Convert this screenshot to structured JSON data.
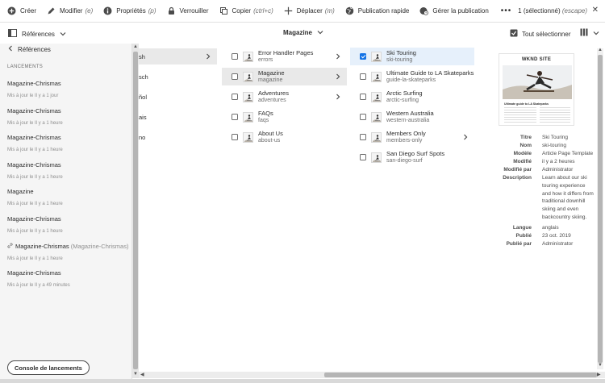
{
  "actionbar": {
    "create": "Créer",
    "edit": "Modifier",
    "edit_shortcut": "(e)",
    "properties": "Propriétés",
    "properties_shortcut": "(p)",
    "lock": "Verrouiller",
    "copy": "Copier",
    "copy_shortcut": "(ctrl+c)",
    "move": "Déplacer",
    "move_shortcut": "(m)",
    "quick_publish": "Publication rapide",
    "manage_publication": "Gérer la publication",
    "more": "•••",
    "selection_count": "1 (sélectionné)",
    "selection_escape": "(escape)"
  },
  "subbar": {
    "rail_label": "Références",
    "breadcrumb": "Magazine",
    "select_all": "Tout sélectionner"
  },
  "rail": {
    "back_label": "Références",
    "section_title": "LANCEMENTS",
    "launches": [
      {
        "title": "Magazine-Chrismas",
        "sub": "",
        "meta": "Mis à jour le Il y a 1 jour"
      },
      {
        "title": "Magazine-Chrismas",
        "sub": "",
        "meta": "Mis à jour le Il y a 1 heure"
      },
      {
        "title": "Magazine-Chrismas",
        "sub": "",
        "meta": "Mis à jour le Il y a 1 heure"
      },
      {
        "title": "Magazine-Chrismas",
        "sub": "",
        "meta": "Mis à jour le Il y a 1 heure"
      },
      {
        "title": "Magazine",
        "sub": "",
        "meta": "Mis à jour le Il y a 1 heure"
      },
      {
        "title": "Magazine-Chrismas",
        "sub": "",
        "meta": "Mis à jour le Il y a 1 heure"
      },
      {
        "title": "Magazine-Chrismas",
        "sub": "(Magazine-Chrismas)",
        "meta": "Mis à jour le Il y a 1 heure"
      },
      {
        "title": "Magazine-Chrismas",
        "sub": "",
        "meta": "Mis à jour le Il y a 49 minutes"
      }
    ],
    "console_button": "Console de lancements"
  },
  "column0": [
    "sh",
    "sch",
    "ñol",
    "ais",
    "no"
  ],
  "column1": [
    {
      "title": "Error Handler Pages",
      "name": "errors",
      "has_children": true
    },
    {
      "title": "Magazine",
      "name": "magazine",
      "has_children": true
    },
    {
      "title": "Adventures",
      "name": "adventures",
      "has_children": true
    },
    {
      "title": "FAQs",
      "name": "faqs",
      "has_children": false
    },
    {
      "title": "About Us",
      "name": "about-us",
      "has_children": false
    }
  ],
  "column2": [
    {
      "title": "Ski Touring",
      "name": "ski-touring",
      "has_children": false,
      "checked": true
    },
    {
      "title": "Ultimate Guide to LA Skateparks",
      "name": "guide-la-skateparks",
      "has_children": false,
      "checked": false
    },
    {
      "title": "Arctic Surfing",
      "name": "arctic-surfing",
      "has_children": false,
      "checked": false
    },
    {
      "title": "Western Australia",
      "name": "western-australia",
      "has_children": false,
      "checked": false
    },
    {
      "title": "Members Only",
      "name": "members-only",
      "has_children": true,
      "checked": false
    },
    {
      "title": "San Diego Surf Spots",
      "name": "san-diego-surf",
      "has_children": false,
      "checked": false
    }
  ],
  "preview": {
    "thumb_brand": "WKND SITE",
    "thumb_heading": "Ultimate guide to LA Skateparks",
    "fields": [
      {
        "label": "Titre",
        "value": "Ski Touring"
      },
      {
        "label": "Nom",
        "value": "ski-touring"
      },
      {
        "label": "Modèle",
        "value": "Article Page Template"
      },
      {
        "label": "Modifié",
        "value": "il y a 2 heures"
      },
      {
        "label": "Modifié par",
        "value": "Administrator"
      },
      {
        "label": "Description",
        "value": "Learn about our ski touring experience and how it differs from traditional downhill skiing and even backcountry skiing."
      },
      {
        "label": "Langue",
        "value": "anglais"
      },
      {
        "label": "Publié",
        "value": "23 oct. 2019"
      },
      {
        "label": "Publié par",
        "value": "Administrator"
      }
    ]
  },
  "colors": {
    "accent": "#1473e6",
    "rail_bg": "#f5f5f5",
    "selected_bg": "#e6f0fb"
  }
}
